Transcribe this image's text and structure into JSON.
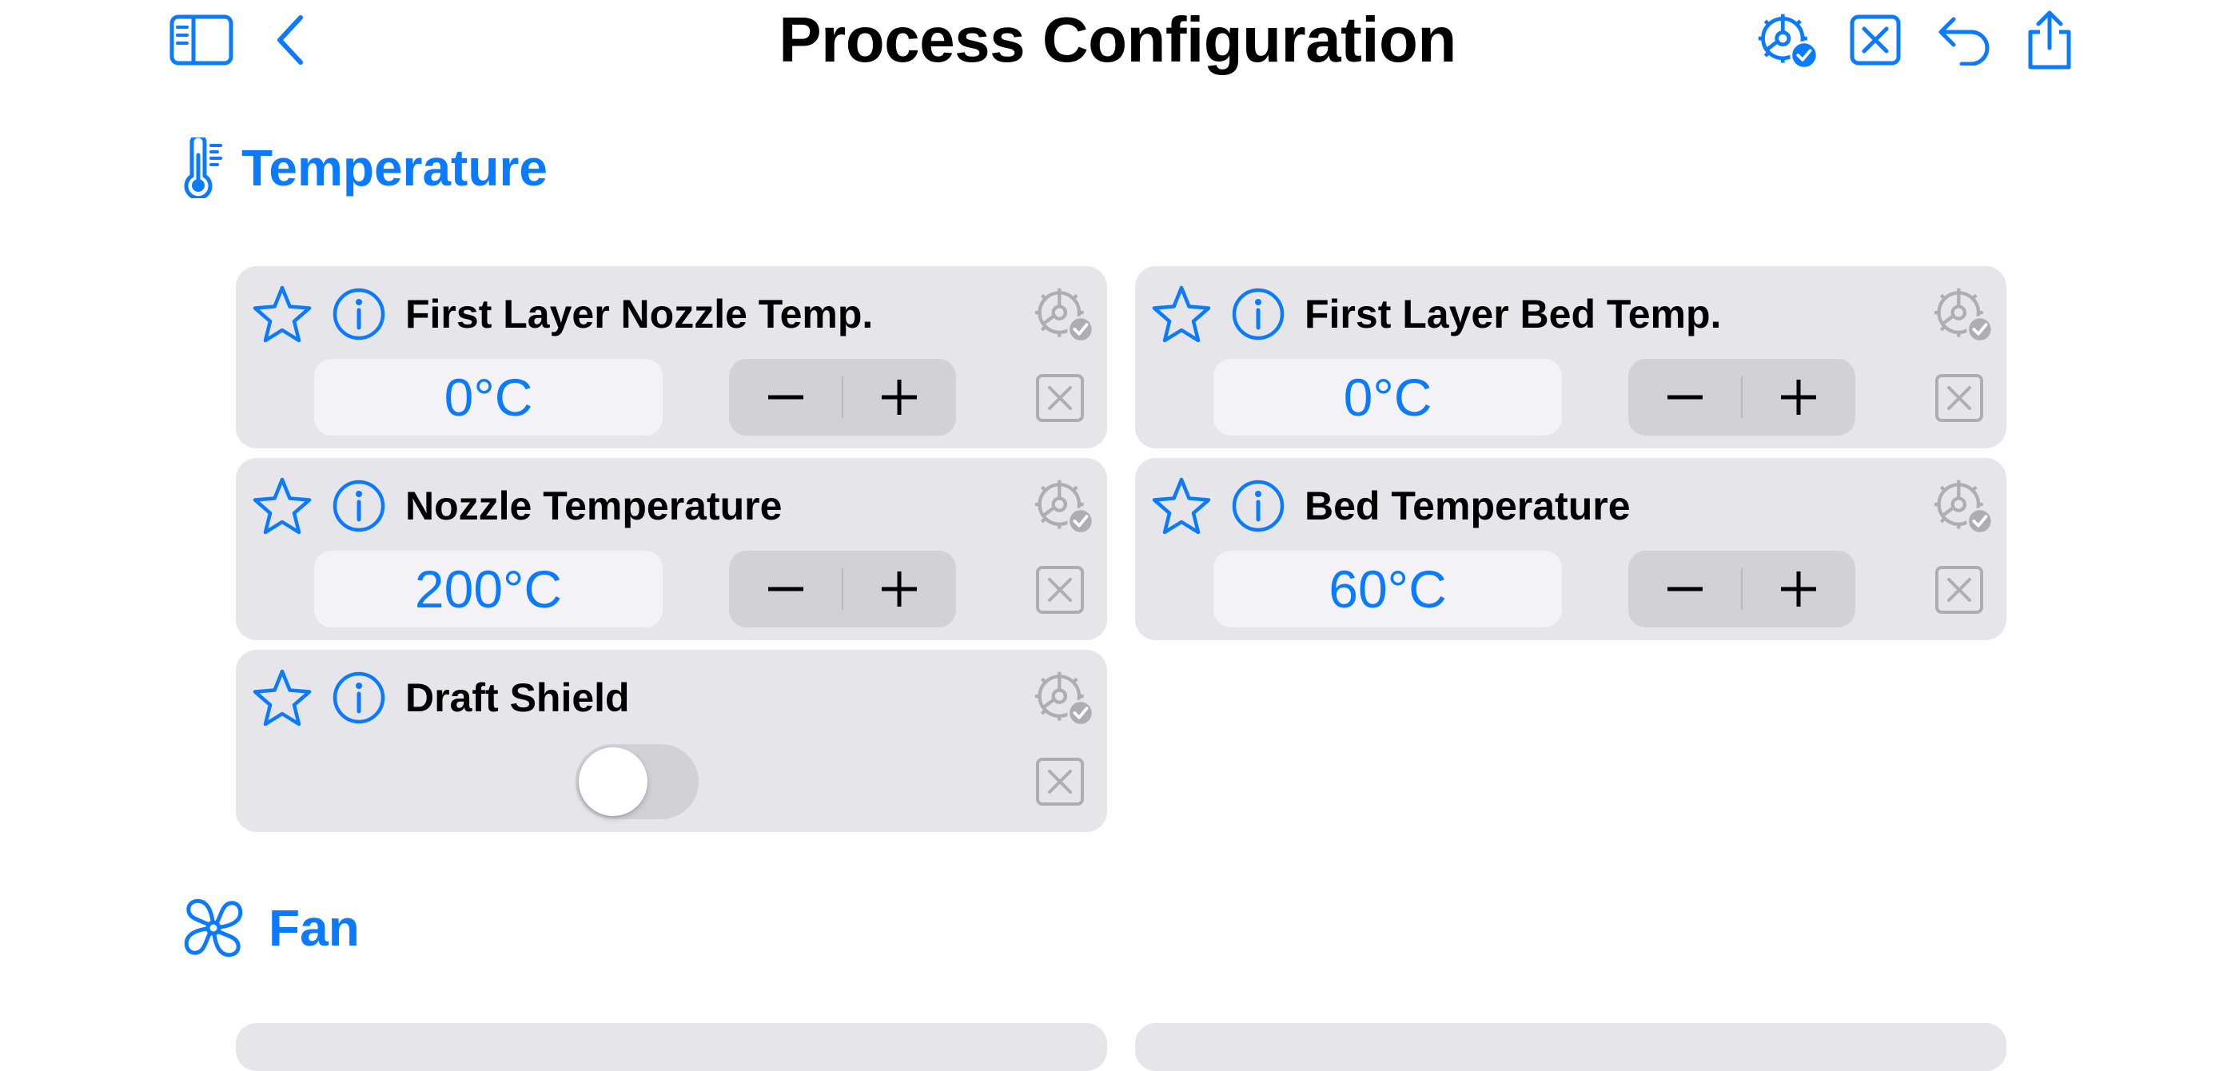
{
  "header": {
    "title": "Process Configuration",
    "icons": [
      "sidebar-icon",
      "back-chevron-icon",
      "gear-check-icon",
      "close-box-icon",
      "undo-icon",
      "share-icon"
    ]
  },
  "sections": [
    {
      "title": "Temperature",
      "icon": "thermometer-icon",
      "settings": [
        {
          "label": "First Layer Nozzle Temp.",
          "value": "0°C",
          "type": "stepper"
        },
        {
          "label": "First Layer Bed Temp.",
          "value": "0°C",
          "type": "stepper"
        },
        {
          "label": "Nozzle Temperature",
          "value": "200°C",
          "type": "stepper"
        },
        {
          "label": "Bed Temperature",
          "value": "60°C",
          "type": "stepper"
        },
        {
          "label": "Draft Shield",
          "value": "off",
          "type": "toggle"
        }
      ]
    },
    {
      "title": "Fan",
      "icon": "fan-icon"
    }
  ],
  "colors": {
    "accent": "#0a7aff",
    "card_background": "#e5e5ea",
    "field_background": "#f2f2f7",
    "stepper_background": "#d1d1d6",
    "disabled_icon": "#aeaeb2"
  }
}
